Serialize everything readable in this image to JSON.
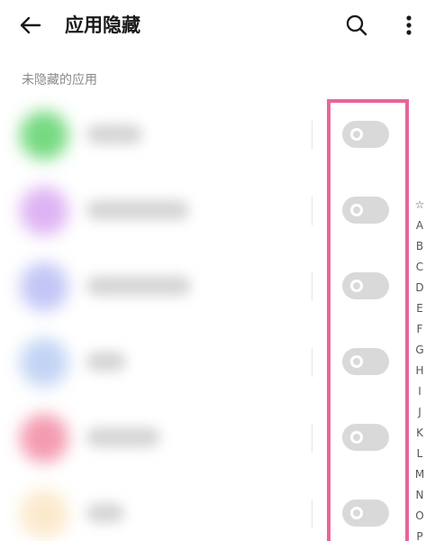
{
  "header": {
    "title": "应用隐藏",
    "back_icon": "arrow-left-icon",
    "search_icon": "search-icon",
    "more_icon": "more-vertical-icon"
  },
  "section": {
    "label": "未隐藏的应用"
  },
  "apps": [
    {
      "name": "",
      "icon_color": "#5fd36b",
      "toggle_on": false
    },
    {
      "name": "",
      "icon_color": "#d9a6f2",
      "toggle_on": false
    },
    {
      "name": "",
      "icon_color": "#b9bcf5",
      "toggle_on": false
    },
    {
      "name": "",
      "icon_color": "#b8cdf2",
      "toggle_on": false
    },
    {
      "name": "",
      "icon_color": "#f28aa3",
      "toggle_on": false
    },
    {
      "name": "",
      "icon_color": "#fbe6c4",
      "toggle_on": false
    }
  ],
  "index_bar": [
    "☆",
    "A",
    "B",
    "C",
    "D",
    "E",
    "F",
    "G",
    "H",
    "I",
    "J",
    "K",
    "L",
    "M",
    "N",
    "O",
    "P"
  ],
  "colors": {
    "highlight": "#e8659a",
    "toggle_off": "#d9d9d9"
  }
}
